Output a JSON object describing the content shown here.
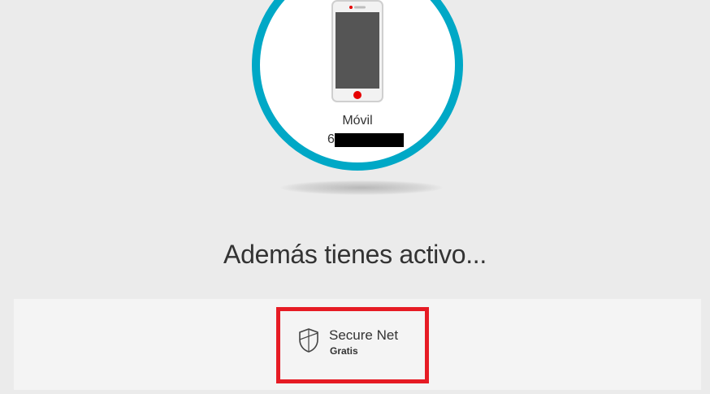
{
  "device": {
    "icon": "smartphone-icon",
    "name": "Móvil",
    "number_visible": "6",
    "number_redacted": true,
    "ring_color": "#00a8c6"
  },
  "extras": {
    "title": "Además tienes activo...",
    "services": [
      {
        "icon": "shield-icon",
        "name": "Secure Net",
        "price": "Gratis",
        "highlight_color": "#e61b24"
      }
    ]
  }
}
